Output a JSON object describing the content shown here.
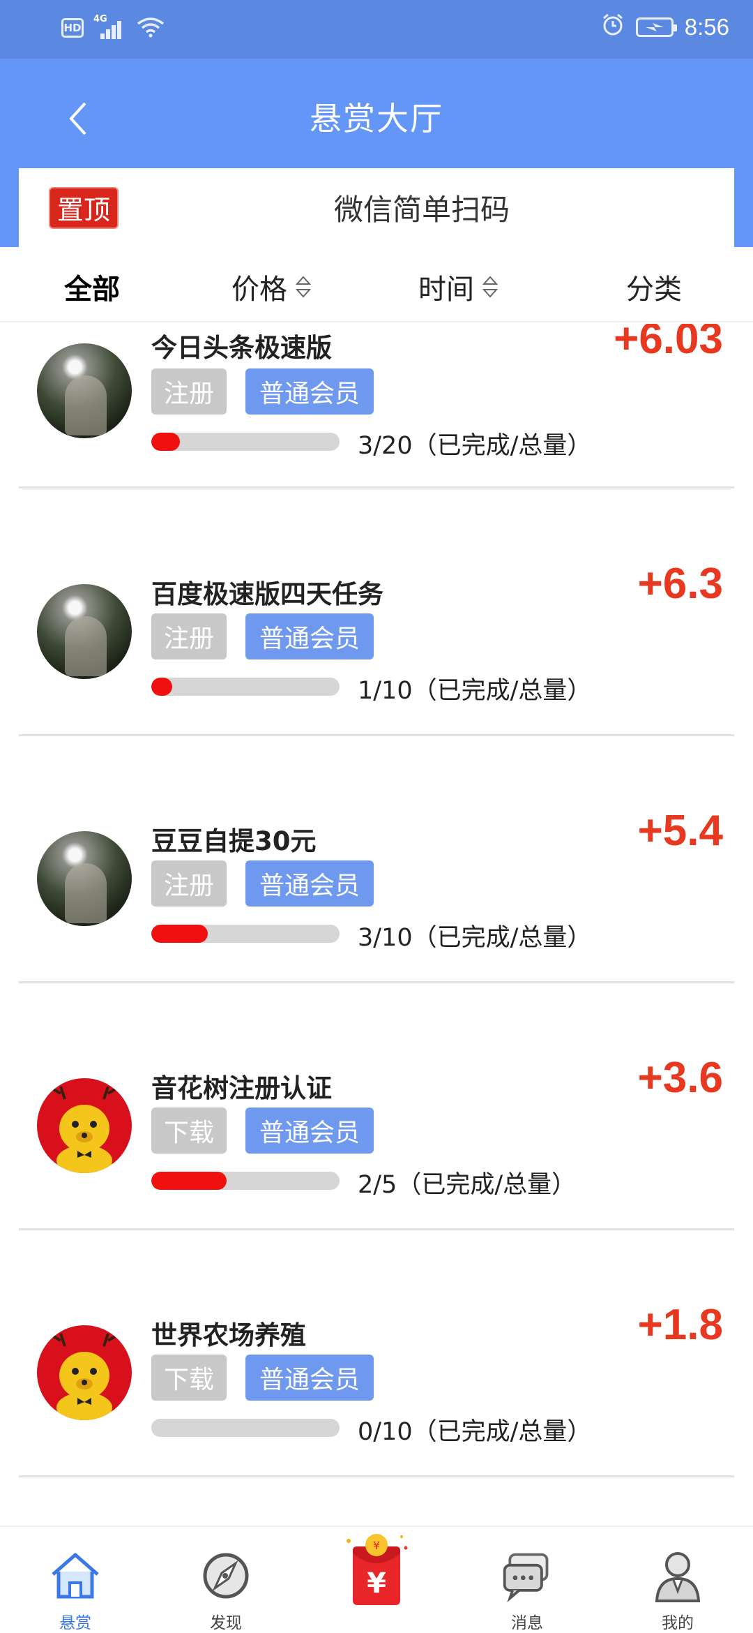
{
  "status_bar": {
    "hd": "HD",
    "network": "4G",
    "time": "8:56"
  },
  "header": {
    "title": "悬赏大厅",
    "back_icon": "chevron-left-icon"
  },
  "pinned": {
    "badge": "置顶",
    "text": "微信简单扫码"
  },
  "tabs": [
    {
      "label": "全部",
      "active": true
    },
    {
      "label": "价格",
      "sortable": true
    },
    {
      "label": "时间",
      "sortable": true
    },
    {
      "label": "分类"
    }
  ],
  "tasks": [
    {
      "title": "今日头条极速版",
      "reward": "+6.03",
      "tag_type": "注册",
      "tag_member": "普通会员",
      "progress_text": "3/20（已完成/总量）",
      "done": 3,
      "total": 20,
      "avatar": "photo-avatar"
    },
    {
      "title": "百度极速版四天任务",
      "reward": "+6.3",
      "tag_type": "注册",
      "tag_member": "普通会员",
      "progress_text": "1/10（已完成/总量）",
      "done": 1,
      "total": 10,
      "avatar": "photo-avatar"
    },
    {
      "title": "豆豆自提30元",
      "reward": "+5.4",
      "tag_type": "注册",
      "tag_member": "普通会员",
      "progress_text": "3/10（已完成/总量）",
      "done": 3,
      "total": 10,
      "avatar": "photo-avatar"
    },
    {
      "title": "音花树注册认证",
      "reward": "+3.6",
      "tag_type": "下载",
      "tag_member": "普通会员",
      "progress_text": "2/5（已完成/总量）",
      "done": 2,
      "total": 5,
      "avatar": "deer-avatar"
    },
    {
      "title": "世界农场养殖",
      "reward": "+1.8",
      "tag_type": "下载",
      "tag_member": "普通会员",
      "progress_text": "0/10（已完成/总量）",
      "done": 0,
      "total": 10,
      "avatar": "deer-avatar"
    }
  ],
  "bottom_nav": [
    {
      "label": "悬赏",
      "icon": "home-icon",
      "active": true
    },
    {
      "label": "发现",
      "icon": "compass-icon"
    },
    {
      "label": "",
      "icon": "red-envelope-icon"
    },
    {
      "label": "消息",
      "icon": "chat-icon"
    },
    {
      "label": "我的",
      "icon": "user-icon"
    }
  ],
  "colors": {
    "header_blue": "#6496f7",
    "status_blue": "#5b88e0",
    "reward_red": "#e8381f",
    "progress_red": "#f01010",
    "member_tag_blue": "#6e99ee",
    "type_tag_gray": "#c8c8c8",
    "active_nav": "#3a78e8"
  }
}
